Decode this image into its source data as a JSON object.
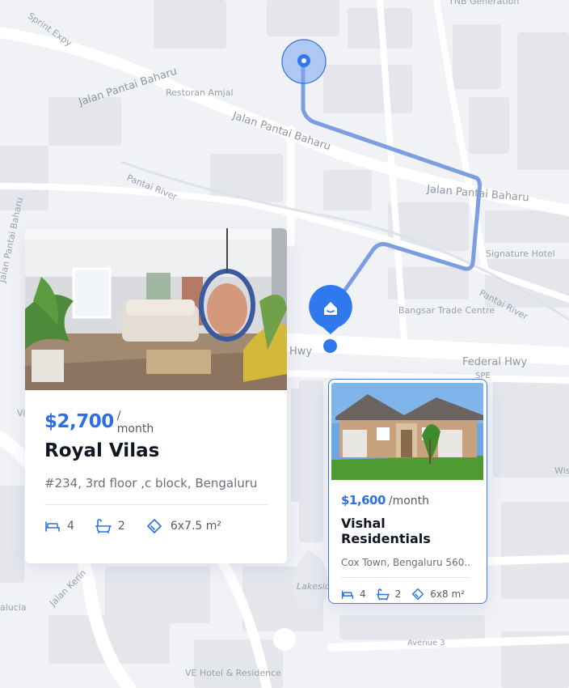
{
  "map": {
    "labels": {
      "tnb": "TNB Generation",
      "sprint": "Sprint Expy",
      "jalan1": "Jalan Pantai Baharu",
      "restoran": "Restoran Amjal",
      "jalan2": "Jalan Pantai Baharu",
      "jalan3": "Jalan Pantai Baharu",
      "jalan_left": "Jalan Pantai Baharu",
      "pantai_river1": "Pantai River",
      "pantai_river2": "Pantai River",
      "signature": "Signature Hotel",
      "bangsar": "Bangsar Trade Centre",
      "hwy": "Hwy",
      "federal": "Federal Hwy",
      "spe": "SPE",
      "wis": "Wis",
      "vi": "Vi",
      "jalan_kerin": "Jalan Kerin",
      "lakeside": "Lakesid",
      "alucia": "alucia",
      "avenue3": "Avenue 3",
      "ve_hotel": "VE Hotel & Residence"
    }
  },
  "listings": [
    {
      "price": "$2,700",
      "per": "/",
      "per2": "month",
      "title": "Royal Vilas",
      "address": "#234, 3rd floor ,c block, Bengaluru",
      "beds": "4",
      "baths": "2",
      "area": "6x7.5 m²"
    },
    {
      "price": "$1,600",
      "per": "/month",
      "title": "Vishal Residentials",
      "address": "Cox Town, Bengaluru 560..",
      "beds": "4",
      "baths": "2",
      "area": "6x8 m²"
    }
  ],
  "colors": {
    "accent": "#2f6fe6",
    "route": "#5a86dc",
    "pin": "#2f78ee"
  }
}
